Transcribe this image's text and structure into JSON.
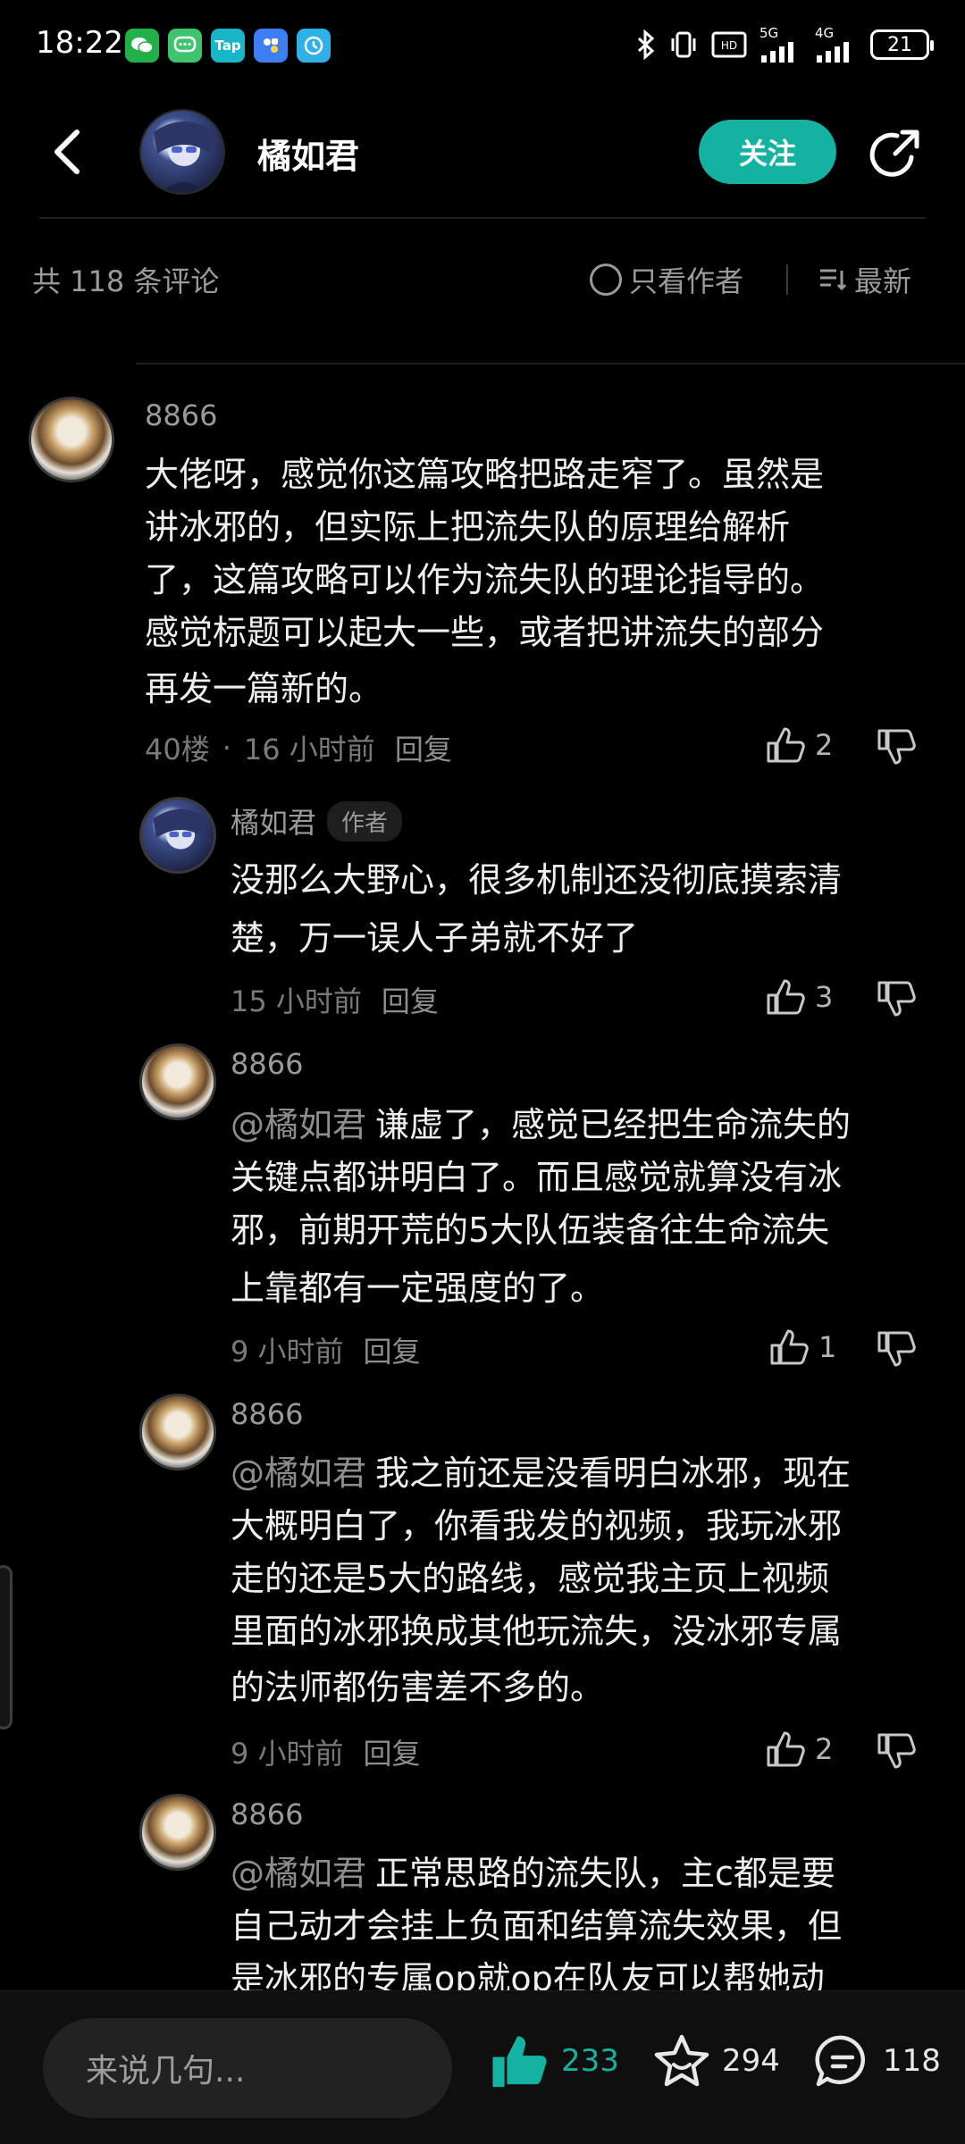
{
  "status_bar": {
    "time": "18:22",
    "apps": [
      "wechat",
      "messages",
      "Tap",
      "app",
      "app"
    ],
    "battery": "21",
    "network": [
      "5G",
      "4G"
    ]
  },
  "header": {
    "name": "橘如君",
    "follow_label": "关注"
  },
  "filter": {
    "count_text": "共 118 条评论",
    "only_author": "只看作者",
    "sort": "最新"
  },
  "comments": [
    {
      "user": "8866",
      "text_lines": [
        "大佬呀，感觉你这篇攻略把路走窄了。虽然是",
        "讲冰邪的，但实际上把流失队的原理给解析",
        "了，这篇攻略可以作为流失队的理论指导的。",
        "感觉标题可以起大一些，或者把讲流失的部分",
        "再发一篇新的。"
      ],
      "floor": "40楼",
      "dot": "·",
      "time": "16 小时前",
      "reply": "回复",
      "likes": "2"
    },
    {
      "user": "橘如君",
      "badge": "作者",
      "text_lines": [
        "没那么大野心，很多机制还没彻底摸索清",
        "楚，万一误人子弟就不好了"
      ],
      "time": "15 小时前",
      "reply": "回复",
      "likes": "3"
    },
    {
      "user": "8866",
      "mention": "@橘如君",
      "text_lines": [
        "谦虚了，感觉已经把生命流失的",
        "关键点都讲明白了。而且感觉就算没有冰",
        "邪，前期开荒的5大队伍装备往生命流失",
        "上靠都有一定强度的了。"
      ],
      "time": "9 小时前",
      "reply": "回复",
      "likes": "1"
    },
    {
      "user": "8866",
      "mention": "@橘如君",
      "text_lines": [
        "我之前还是没看明白冰邪，现在",
        "大概明白了，你看我发的视频，我玩冰邪",
        "走的还是5大的路线，感觉我主页上视频",
        "里面的冰邪换成其他玩流失，没冰邪专属",
        "的法师都伤害差不多的。"
      ],
      "time": "9 小时前",
      "reply": "回复",
      "likes": "2"
    },
    {
      "user": "8866",
      "mention": "@橘如君",
      "text_lines": [
        "正常思路的流失队，主c都是要",
        "自己动才会挂上负面和结算流失效果，但",
        "是冰邪的专属op就op在队友可以帮她动"
      ]
    }
  ],
  "bottom_bar": {
    "input_placeholder": "来说几句...",
    "likes": "233",
    "favorites": "294",
    "comments": "118"
  },
  "colors": {
    "accent": "#14b3a1",
    "background": "#000000",
    "text_primary": "#eeeeee",
    "text_secondary": "#9a9a9a"
  }
}
